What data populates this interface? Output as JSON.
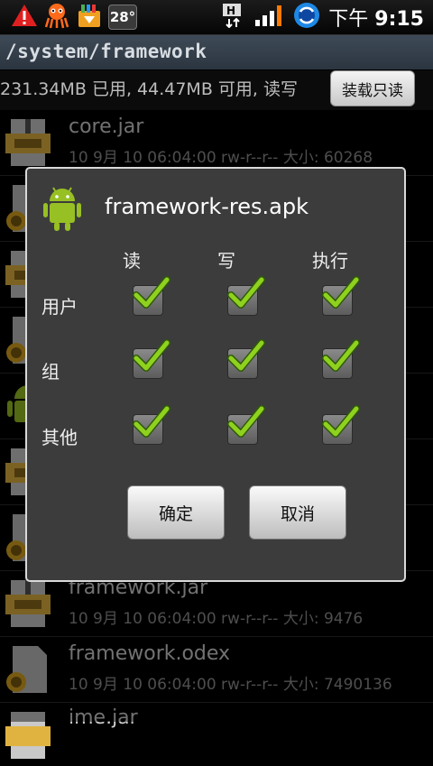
{
  "status_bar": {
    "temperature": "28°",
    "time_prefix": "下午",
    "time": "9:15",
    "icons": [
      "warning-icon",
      "octopus-icon",
      "store-icon",
      "temperature-icon",
      "hspa-icon",
      "signal-icon",
      "sync-icon"
    ]
  },
  "path": {
    "current": "/system/framework"
  },
  "storage": {
    "summary": "231.34MB 已用, 44.47MB 可用, 读写",
    "mount_button": "装载只读"
  },
  "files": [
    {
      "name": "core.jar",
      "meta": "10 9月 10 06:04:00  rw-r--r--   大小: 60268",
      "icon": "zip-icon"
    },
    {
      "name": "",
      "meta": "",
      "icon": "odex-icon"
    },
    {
      "name": "",
      "meta": "",
      "icon": "zip-icon"
    },
    {
      "name": "",
      "meta": "",
      "icon": "odex-icon"
    },
    {
      "name": "",
      "meta": "",
      "icon": "android-icon"
    },
    {
      "name": "",
      "meta": "",
      "icon": "zip-icon"
    },
    {
      "name": "",
      "meta": "",
      "icon": "odex-icon"
    },
    {
      "name": "framework.jar",
      "meta": "10 9月 10 06:04:00  rw-r--r--   大小: 9476",
      "icon": "zip-icon"
    },
    {
      "name": "framework.odex",
      "meta": "10 9月 10 06:04:00  rw-r--r--   大小: 7490136",
      "icon": "odex-icon"
    },
    {
      "name": "ime.jar",
      "meta": "",
      "icon": "zip-icon"
    }
  ],
  "dialog": {
    "title": "framework-res.apk",
    "columns": [
      "读",
      "写",
      "执行"
    ],
    "rows": [
      {
        "label": "用户",
        "checked": [
          true,
          true,
          true
        ]
      },
      {
        "label": "组",
        "checked": [
          true,
          true,
          true
        ]
      },
      {
        "label": "其他",
        "checked": [
          true,
          true,
          true
        ]
      }
    ],
    "ok_label": "确定",
    "cancel_label": "取消"
  }
}
